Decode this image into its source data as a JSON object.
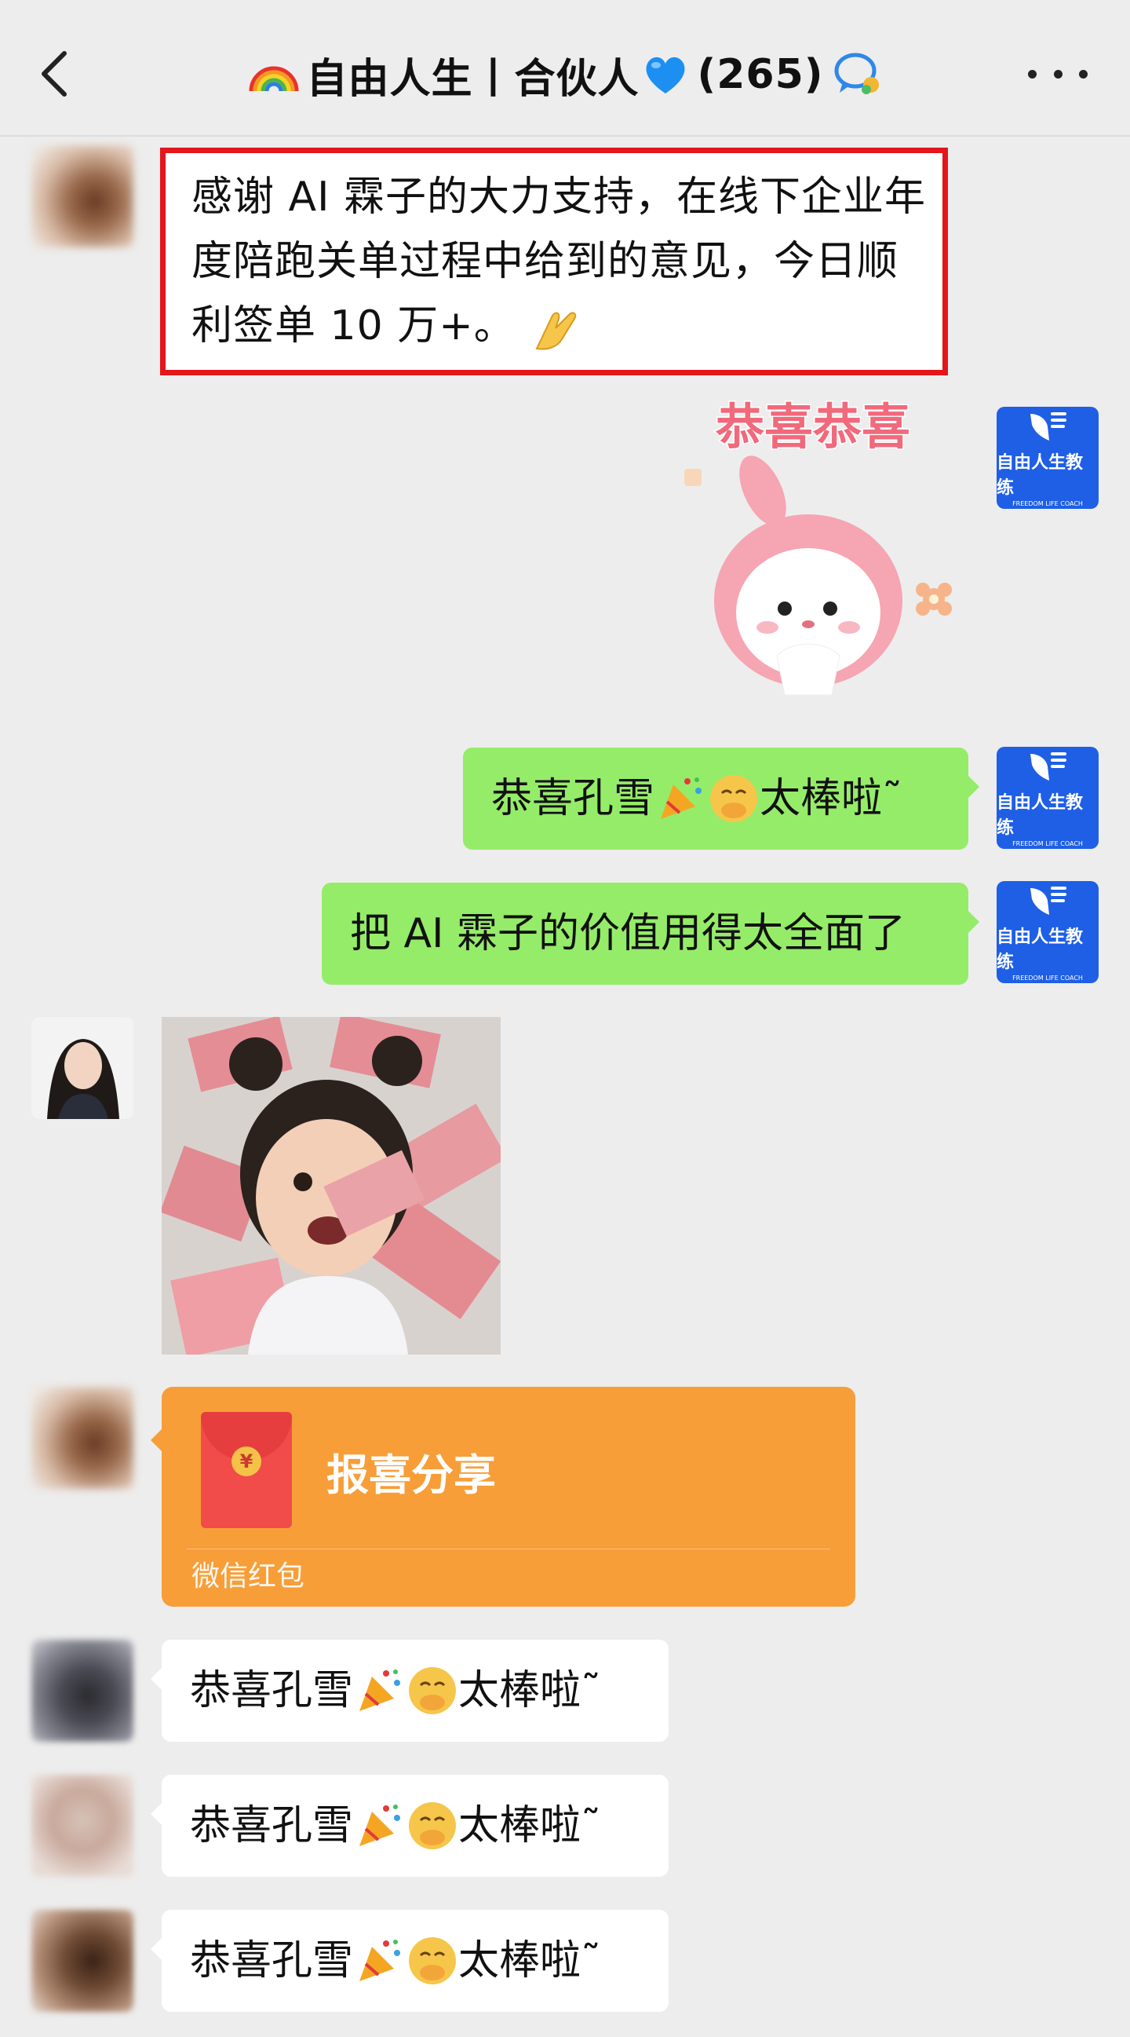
{
  "header": {
    "title": "自由人生丨合伙人",
    "member_count": "(265)",
    "icons": [
      "back-chevron-icon",
      "rainbow-icon",
      "blue-heart-icon",
      "group-chat-icon",
      "more-dots-icon"
    ]
  },
  "messages": [
    {
      "type": "text",
      "side": "left",
      "text": "感谢 AI 霖子的大力支持，在线下企业年度陪跑关单过程中给到的意见，今日顺利签单 10 万+。",
      "highlighted": true,
      "emoji_after": "folded-hands"
    },
    {
      "type": "sticker",
      "side": "right",
      "text": "恭喜恭喜"
    },
    {
      "type": "text",
      "side": "right",
      "text_a": "恭喜孔雪",
      "text_b": "太棒啦˜"
    },
    {
      "type": "text",
      "side": "right",
      "text": "把 AI 霖子的价值用得太全面了"
    },
    {
      "type": "image",
      "side": "left"
    },
    {
      "type": "red_packet",
      "side": "left",
      "title": "报喜分享",
      "label": "微信红包"
    },
    {
      "type": "text",
      "side": "left",
      "text_a": "恭喜孔雪",
      "text_b": "太棒啦˜"
    },
    {
      "type": "text",
      "side": "left",
      "text_a": "恭喜孔雪",
      "text_b": "太棒啦˜"
    },
    {
      "type": "text",
      "side": "left",
      "text_a": "恭喜孔雪",
      "text_b": "太棒啦˜"
    }
  ],
  "coach_avatar": {
    "name": "自由人生教练",
    "sub": "FREEDOM LIFE COACH"
  },
  "colors": {
    "background": "#ededed",
    "green_bubble": "#95ec69",
    "highlight_border": "#e3161b",
    "red_packet": "#f79e39",
    "coach_blue": "#1e5fe6"
  }
}
